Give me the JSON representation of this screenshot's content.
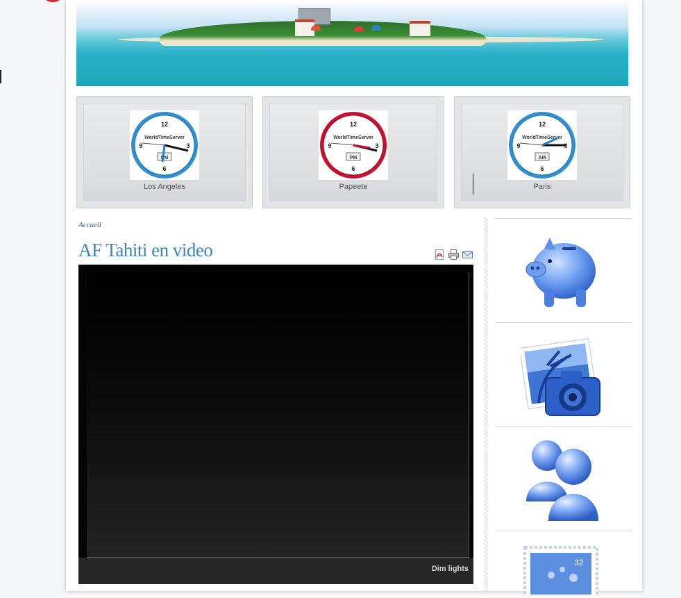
{
  "clocks": [
    {
      "city": "Los Angeles",
      "brand": "WorldTimeServer",
      "period": "PM",
      "numerals": [
        "12",
        "3",
        "6",
        "9"
      ],
      "ring_color": "#2f8fd0"
    },
    {
      "city": "Papeete",
      "brand": "WorldTimeServer",
      "period": "PM",
      "numerals": [
        "12",
        "3",
        "6",
        "9"
      ],
      "ring_color": "#c9102e"
    },
    {
      "city": "Paris",
      "brand": "WorldTimeServer",
      "period": "AM",
      "numerals": [
        "12",
        "3",
        "6",
        "9"
      ],
      "ring_color": "#2f8fd0"
    }
  ],
  "article": {
    "breadcrumb": "Accueil",
    "title": "AF Tahiti en video",
    "tools": [
      {
        "name": "pdf-icon"
      },
      {
        "name": "print-icon"
      },
      {
        "name": "email-icon"
      }
    ]
  },
  "video": {
    "dim_label": "Dim lights"
  },
  "sidebar": {
    "icons": [
      {
        "name": "piggy-bank-icon"
      },
      {
        "name": "photo-camera-icon"
      },
      {
        "name": "users-icon"
      },
      {
        "name": "stamp-icon",
        "stamp_value": "32"
      }
    ]
  },
  "colors": {
    "title": "#3a86c1",
    "breadcrumb": "#2a5d8c",
    "accent_blue": "#3a7fd5"
  }
}
